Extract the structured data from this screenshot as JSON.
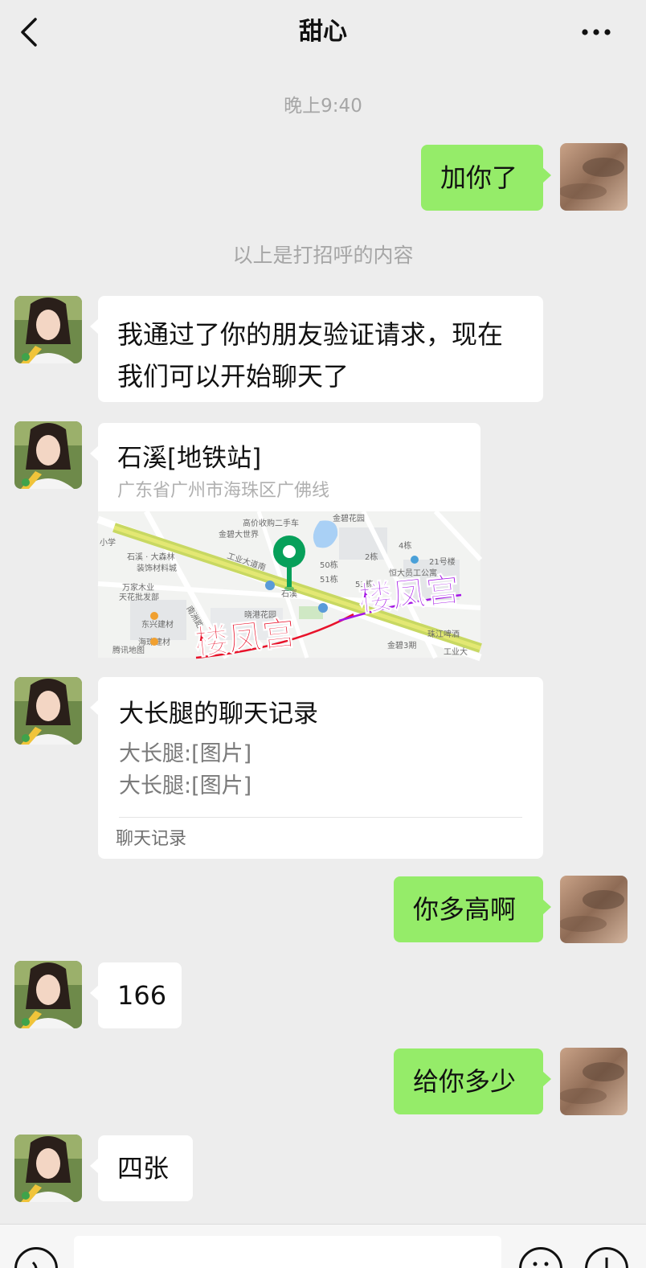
{
  "header": {
    "title": "甜心",
    "back_icon": "chevron-left-icon",
    "more_icon": "more-dots-icon"
  },
  "chat": {
    "timestamp": "晚上9:40",
    "system_notice": "以上是打招呼的内容",
    "messages": [
      {
        "from": "me",
        "text": "加你了"
      },
      {
        "from": "them",
        "line1": "我通过了你的朋友验证请求，现在",
        "line2": "我们可以开始聊天了"
      },
      {
        "from": "them",
        "type": "location",
        "name": "石溪[地铁站]",
        "address": "广东省广州市海珠区广佛线",
        "map": {
          "labels": [
            "高价收购二手车",
            "金碧花园",
            "金碧大世界",
            "石溪 · 大森林",
            "装饰材料城",
            "工业大道南",
            "万家木业",
            "天花批发部",
            "东兴建材",
            "石溪",
            "晓港花园",
            "南洲路",
            "50栋",
            "51栋",
            "53栋",
            "恒大员工公寓",
            "2栋",
            "4栋",
            "21号楼",
            "金碧3期",
            "工业大",
            "珠江啤酒",
            "腾讯地图",
            "海珠建材",
            "小学"
          ],
          "watermark": "楼凤宫"
        }
      },
      {
        "from": "them",
        "type": "chat-record",
        "title": "大长腿的聊天记录",
        "line1": "大长腿:[图片]",
        "line2": "大长腿:[图片]",
        "footer": "聊天记录"
      },
      {
        "from": "me",
        "text": "你多高啊"
      },
      {
        "from": "them",
        "text": "166"
      },
      {
        "from": "me",
        "text": "给你多少"
      },
      {
        "from": "them",
        "text": "四张"
      }
    ]
  },
  "colors": {
    "background": "#ededed",
    "my_bubble": "#95ec69",
    "their_bubble": "#ffffff",
    "map_pin": "#07a05a",
    "watermark_red": "#e8122a",
    "watermark_purple": "#a414e6"
  },
  "inputbar": {
    "voice_icon": "voice-icon",
    "emoji_icon": "emoji-icon",
    "plus_icon": "plus-icon"
  }
}
